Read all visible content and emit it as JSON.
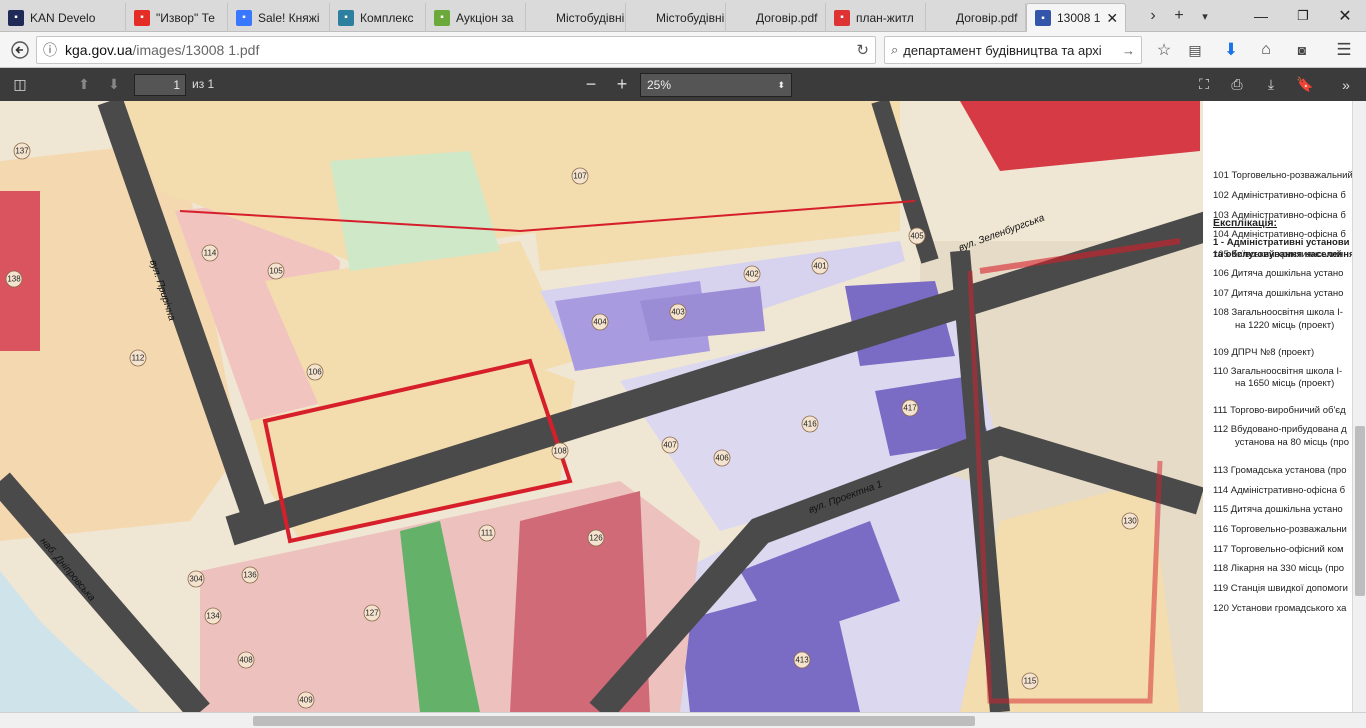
{
  "tabs": [
    {
      "label": "KAN Develo",
      "icon": "kan-icon",
      "color": "#1f2a56"
    },
    {
      "label": "\"Извор\" Те",
      "icon": "youtube-icon",
      "color": "#e52d27"
    },
    {
      "label": "Sale! Княжі",
      "icon": "olx-icon",
      "color": "#3a77ff"
    },
    {
      "label": "Комплекс",
      "icon": "diamond-icon",
      "color": "#2d7fa0"
    },
    {
      "label": "Аукціон за",
      "icon": "prozorro-icon",
      "color": "#6ba93a"
    },
    {
      "label": "Містобудівні у",
      "icon": "",
      "color": ""
    },
    {
      "label": "Містобудівні у",
      "icon": "",
      "color": ""
    },
    {
      "label": "Договір.pdf",
      "icon": "",
      "color": ""
    },
    {
      "label": "план-житл",
      "icon": "pdf-icon",
      "color": "#d33"
    },
    {
      "label": "Договір.pdf",
      "icon": "",
      "color": ""
    },
    {
      "label": "13008 1",
      "icon": "kyiv-icon",
      "color": "#3355aa"
    }
  ],
  "nav": {
    "url_host": "kga.gov.ua",
    "url_path": "/images/13008 1.pdf",
    "search_value": "департамент будівництва та архі"
  },
  "pdf": {
    "page_current": "1",
    "page_total": "из 1",
    "zoom": "25%"
  },
  "legend": {
    "title": "Експлікація:",
    "section": [
      "1 - Адміністративні установи",
      "та обслуговування населення"
    ],
    "rows": [
      "101 Торговельно-розважальний",
      "102 Адміністративно-офісна б",
      "103 Адміністративно-офісна б",
      "104 Адміністративно-офісна б",
      "105 Київський християнський",
      "106 Дитяча дошкільна устано",
      "107 Дитяча дошкільна устано",
      "108 Загальноосвітня школа І-",
      "на 1220 місць (проект)",
      "109 ДПРЧ №8 (проект)",
      "110 Загальноосвітня школа І-",
      "на 1650 місць (проект)",
      "111 Торгово-виробничий об'єд",
      "112 Вбудовано-прибудована д",
      "установа на 80 місць (про",
      "113 Громадська установа (про",
      "114 Адміністративно-офісна б",
      "115 Дитяча дошкільна устано",
      "116 Торговельно-розважальни",
      "117 Торговельно-офісний ком",
      "118 Лікарня на 330 місць (про",
      "119 Станція швидкої допомоги",
      "120 Установи громадського ха"
    ]
  },
  "map": {
    "streets": [
      "вул. Прирічна",
      "вул. Зеленбургська",
      "вул. Проектна 1",
      "наб. Дніпровська"
    ],
    "labels": [
      "137",
      "138",
      "114",
      "105",
      "112",
      "106",
      "107",
      "108",
      "402",
      "401",
      "405",
      "404",
      "403",
      "417",
      "416",
      "406",
      "407",
      "111",
      "126",
      "127",
      "136",
      "134",
      "304",
      "408",
      "409",
      "413",
      "115",
      "130"
    ]
  }
}
